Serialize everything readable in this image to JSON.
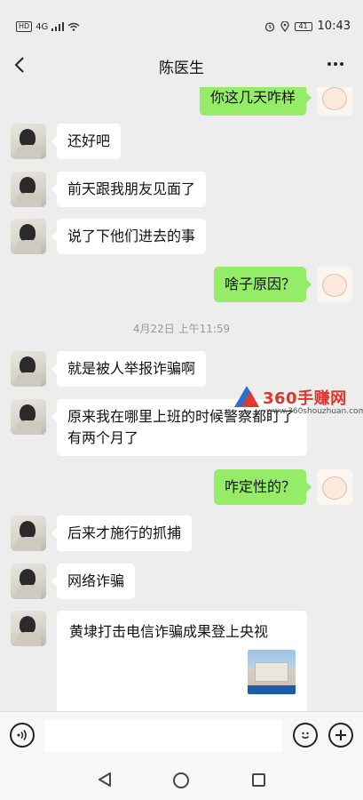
{
  "status_bar": {
    "network": "HD",
    "signal": "4G",
    "time": "10:43",
    "battery": "41"
  },
  "header": {
    "title": "陈医生"
  },
  "messages": [
    {
      "side": "right",
      "text": "你这几天咋样"
    },
    {
      "side": "left",
      "text": "还好吧"
    },
    {
      "side": "left",
      "text": "前天跟我朋友见面了"
    },
    {
      "side": "left",
      "text": "说了下他们进去的事"
    },
    {
      "side": "right",
      "text": "啥子原因？"
    },
    {
      "side": "left",
      "text": "就是被人举报诈骗啊"
    },
    {
      "side": "left",
      "text": "原来我在哪里上班的时候警察都盯了有两个月了"
    },
    {
      "side": "right",
      "text": "咋定性的？"
    },
    {
      "side": "left",
      "text": "后来才施行的抓捕"
    },
    {
      "side": "left",
      "text": "网络诈骗"
    }
  ],
  "timestamp": "4月22日 上午11:59",
  "news_card": {
    "title": "黄埭打击电信诈骗成果登上央视"
  },
  "watermark": {
    "title": "360手赚网",
    "url": "www.360shouzhuan.com"
  },
  "input": {
    "placeholder": ""
  },
  "icons": {
    "back": "chevron-left-icon",
    "more": "more-dots-icon",
    "voice": "voice-icon",
    "emoji": "emoji-icon",
    "plus": "plus-icon"
  },
  "colors": {
    "bg": "#ededed",
    "my_bubble": "#95ec69",
    "their_bubble": "#ffffff"
  }
}
